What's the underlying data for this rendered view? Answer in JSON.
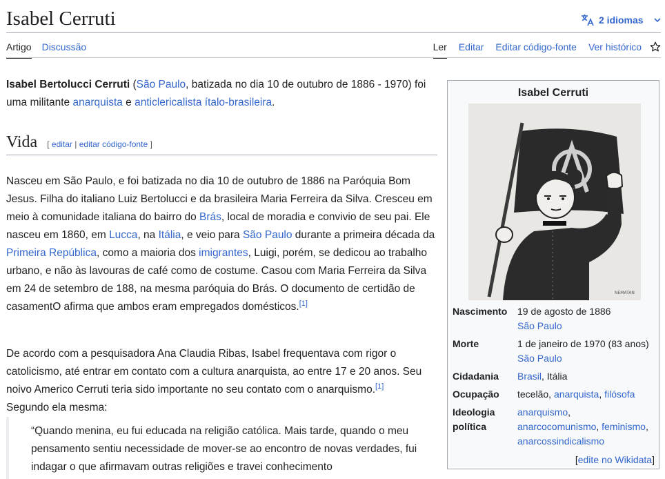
{
  "page": {
    "title": "Isabel Cerruti",
    "languages_label": "2 idiomas"
  },
  "tabs_left": [
    "Artigo",
    "Discussão"
  ],
  "tabs_right": [
    "Ler",
    "Editar",
    "Editar código-fonte",
    "Ver histórico"
  ],
  "intro": {
    "bold_name": "Isabel Bertolucci Cerruti",
    "p1": " (",
    "link_sp": "São Paulo",
    "p2": ", batizada no dia 10 de outubro de 1886 - 1970) foi uma militante ",
    "link_anarq": "anarquista",
    "p3": " e ",
    "link_antic": "anticlericalista ítalo-brasileira",
    "p4": "."
  },
  "section": {
    "heading": "Vida",
    "edit_open": "[ ",
    "edit_link": "editar",
    "edit_sep": " | ",
    "edit_source_link": "editar código-fonte",
    "edit_close": " ]"
  },
  "para1": {
    "t1": "Nasceu em São Paulo, e foi batizada no dia 10 de outubro de 1886 na Paróquia Bom Jesus. Filha do italiano Luiz Bertolucci e da brasileira Maria Ferreira da Silva. Cresceu em meio à comunidade italiana do bairro do ",
    "l1": "Brás",
    "t2": ", local de moradia e convivio de seu pai. Ele nasceu em 1860, em ",
    "l2": "Lucca",
    "t3": ", na ",
    "l3": "Itália",
    "t4": ", e veio para ",
    "l4": "São Paulo",
    "t5": " durante a primeira década da ",
    "l5": "Primeira República",
    "t6": ", como a maioria dos ",
    "l6": "imigrantes",
    "t7": ", Luigi, porém, se dedicou ao trabalho urbano, e não às lavouras de café como de costume. Casou com Maria Ferreira da Silva em 24 de setembro de 188, na mesma paróquia do Brás. O documento de certidão de casamentO afirma que ambos eram empregados domésticos.",
    "ref": "[1]"
  },
  "para2": {
    "t1": "De acordo com a pesquisadora Ana Claudia Ribas, Isabel frequentava com rigor o catolicismo, até entrar em contato com a cultura anarquista, ao entre 17 e 20 anos. Seu noivo Americo Cerruti teria sido importante no seu contato com o anarquismo.",
    "ref": "[1]",
    "t2": " Segundo ela mesma:"
  },
  "quote": "“Quando menina, eu fui educada na religião católica. Mais tarde, quando o meu pensamento sentiu necessidade de mover-se ao encontro de novas verdades, fui indagar o que afirmavam outras religiões e travei conhecimento",
  "infobox": {
    "title": "Isabel Cerruti",
    "image_caption_mark": "NEMATAN",
    "nascimento_label": "Nascimento",
    "nascimento_date": "19 de agosto de 1886",
    "nascimento_place": "São Paulo",
    "morte_label": "Morte",
    "morte_date": "1 de janeiro de 1970 (83 anos)",
    "morte_place": "São Paulo",
    "cidadania_label": "Cidadania",
    "cidadania_link": "Brasil",
    "cidadania_rest": ", Itália",
    "ocupacao_label": "Ocupação",
    "ocupacao_text": "tecelão, ",
    "ocupacao_l1": "anarquista",
    "ocupacao_sep": ", ",
    "ocupacao_l2": "filósofa",
    "ideologia_label": "Ideologia política",
    "ideologia_l1": "anarquismo",
    "ideologia_sep1": ",",
    "ideologia_l2": "anarcocomunismo",
    "ideologia_sep2": ", ",
    "ideologia_l3": "feminismo",
    "ideologia_sep3": ",",
    "ideologia_l4": "anarcossindicalismo",
    "wikidata_open": "[",
    "wikidata_link": "edite no Wikidata",
    "wikidata_close": "]"
  }
}
